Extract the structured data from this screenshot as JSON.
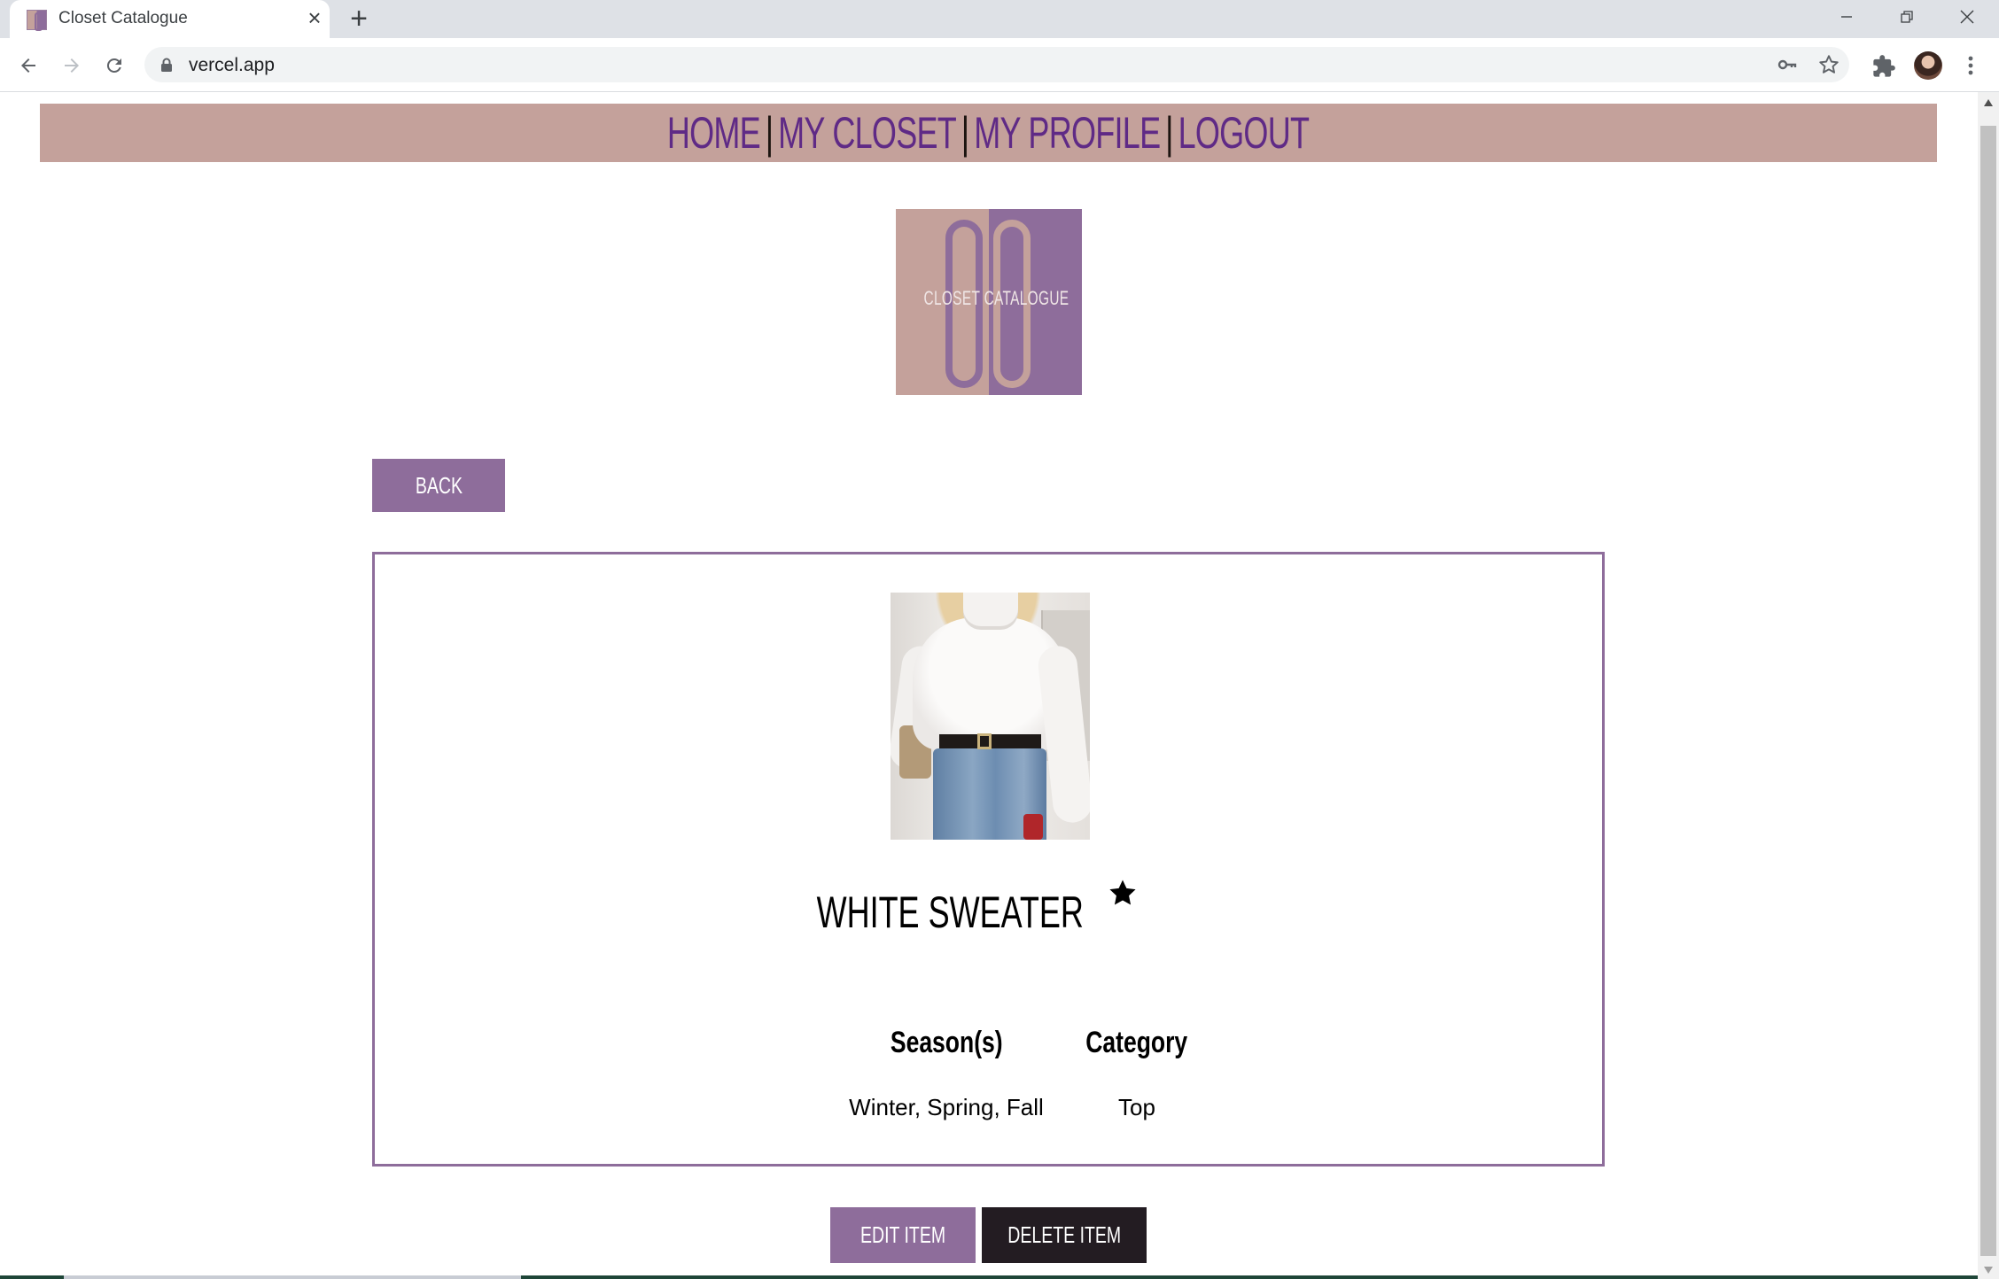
{
  "browser": {
    "tab_title": "Closet Catalogue",
    "url": "vercel.app"
  },
  "nav": {
    "home": "HOME",
    "my_closet": "MY CLOSET",
    "my_profile": "MY PROFILE",
    "logout": "LOGOUT",
    "separator": "|"
  },
  "logo": {
    "text": "CLOSET CATALOGUE"
  },
  "back_label": "BACK",
  "item": {
    "name": "WHITE SWEATER",
    "favorite": true,
    "seasons_header": "Season(s)",
    "category_header": "Category",
    "seasons_value": "Winter, Spring, Fall",
    "category_value": "Top"
  },
  "actions": {
    "edit_label": "EDIT ITEM",
    "delete_label": "DELETE ITEM"
  },
  "colors": {
    "navbar_bg": "#c4a19b",
    "nav_link": "#5f2a86",
    "accent": "#8e6d9b",
    "dark_button": "#231c22"
  },
  "icons": {
    "tab_close": "close-icon",
    "new_tab": "plus-icon",
    "back": "arrow-left-icon",
    "forward": "arrow-right-icon",
    "reload": "reload-icon",
    "lock": "lock-icon",
    "password": "key-icon",
    "bookmark": "star-outline-icon",
    "extensions": "puzzle-icon",
    "menu": "kebab-menu-icon",
    "favorite": "star-filled-icon"
  }
}
